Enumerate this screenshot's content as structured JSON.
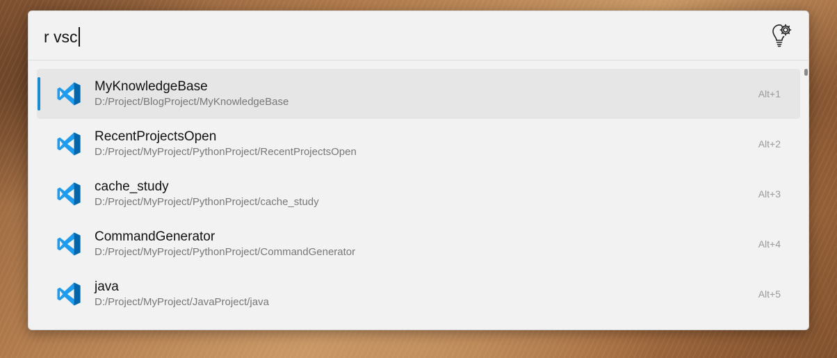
{
  "query": {
    "text": "r vsc"
  },
  "settings": {
    "icon": "lightbulb-gear-icon"
  },
  "results": [
    {
      "title": "MyKnowledgeBase",
      "subtitle": "D:/Project/BlogProject/MyKnowledgeBase",
      "hotkey": "Alt+1",
      "selected": true,
      "icon": "vscode-icon"
    },
    {
      "title": "RecentProjectsOpen",
      "subtitle": "D:/Project/MyProject/PythonProject/RecentProjectsOpen",
      "hotkey": "Alt+2",
      "selected": false,
      "icon": "vscode-icon"
    },
    {
      "title": "cache_study",
      "subtitle": "D:/Project/MyProject/PythonProject/cache_study",
      "hotkey": "Alt+3",
      "selected": false,
      "icon": "vscode-icon"
    },
    {
      "title": "CommandGenerator",
      "subtitle": "D:/Project/MyProject/PythonProject/CommandGenerator",
      "hotkey": "Alt+4",
      "selected": false,
      "icon": "vscode-icon"
    },
    {
      "title": "java",
      "subtitle": "D:/Project/MyProject/JavaProject/java",
      "hotkey": "Alt+5",
      "selected": false,
      "icon": "vscode-icon"
    }
  ],
  "colors": {
    "accent": "#1a8ad4",
    "vscode_blue": "#1f9cf0",
    "vscode_dark": "#0065a9",
    "panel": "#f2f2f2",
    "selected_row": "#e6e6e6"
  }
}
